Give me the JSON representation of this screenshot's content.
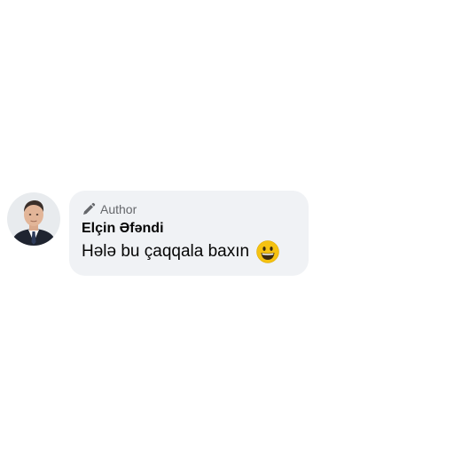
{
  "comment": {
    "badge_label": "Author",
    "badge_icon": "pencil-icon",
    "author_name": "Elçin Əfəndi",
    "text": "Hələ bu çaqqala baxın",
    "emoji": "grinning-face-emoji"
  },
  "colors": {
    "bubble_background": "#f0f2f5",
    "secondary_text": "#65676b",
    "primary_text": "#050505"
  }
}
